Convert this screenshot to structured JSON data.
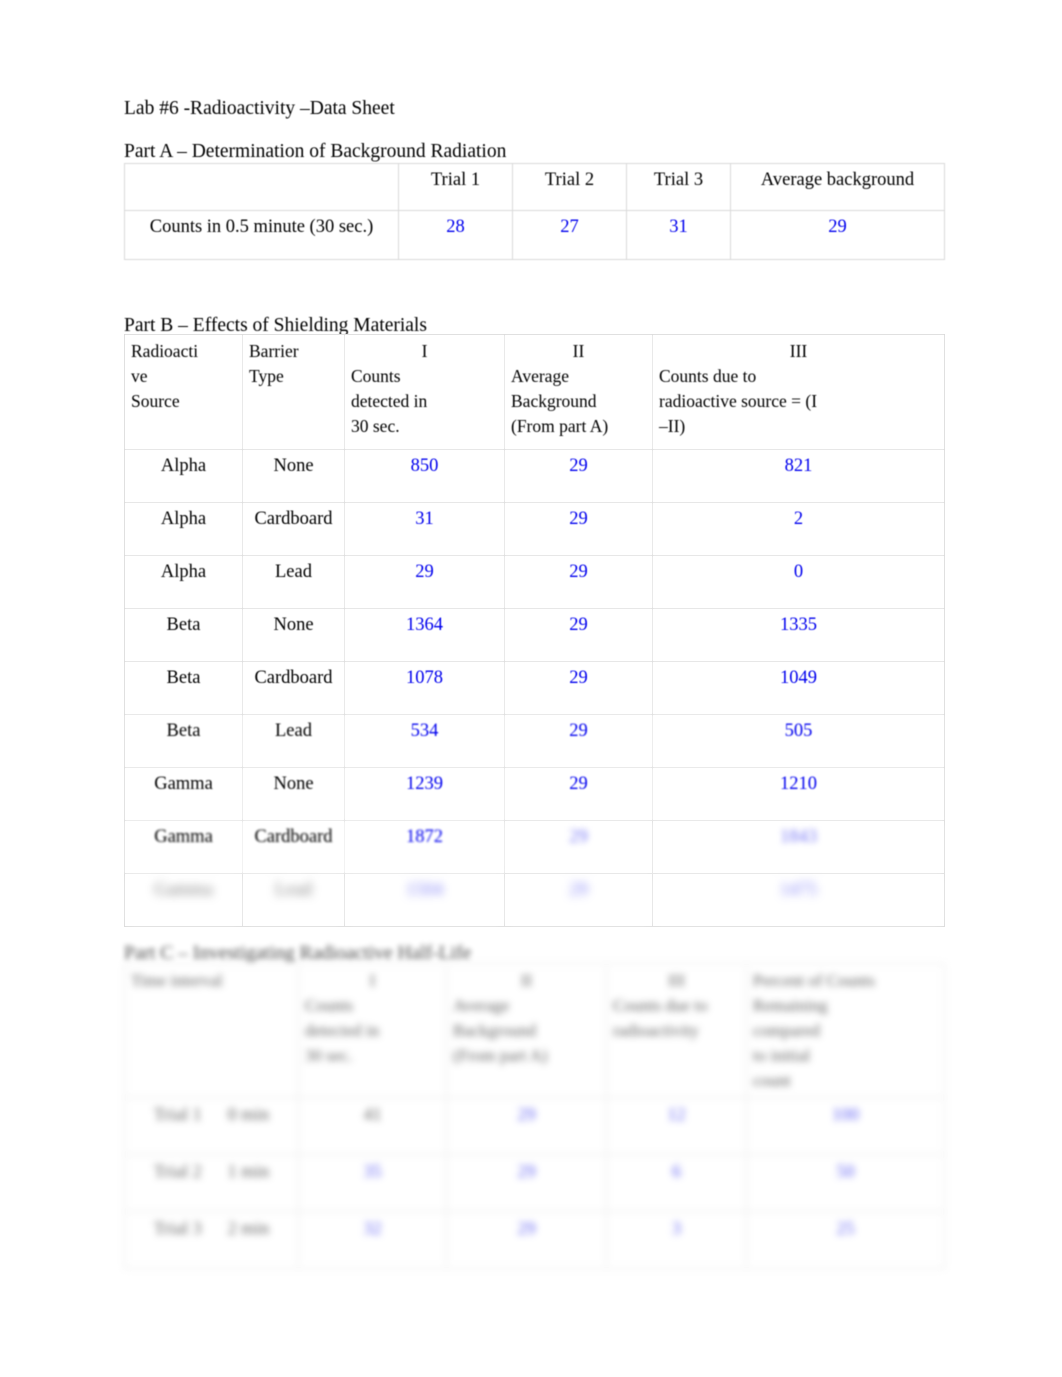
{
  "document": {
    "title": "Lab #6 -Radioactivity –Data Sheet"
  },
  "part_a": {
    "heading": "Part A – Determination of Background Radiation",
    "columns": [
      "",
      "Trial 1",
      "Trial 2",
      "Trial 3",
      "Average background"
    ],
    "row_label": "Counts in 0.5 minute (30 sec.)",
    "values": [
      "28",
      "27",
      "31",
      "29"
    ]
  },
  "part_b": {
    "heading": "Part B – Effects of Shielding Materials",
    "headers": {
      "source": "Radioacti\nve\nSource",
      "source_line1": "Radioacti",
      "source_line2": "ve",
      "source_line3": "Source",
      "barrier_line1": "Barrier",
      "barrier_line2": "Type",
      "col1_num": "I",
      "col1_line1": "Counts",
      "col1_line2": "detected in",
      "col1_line3": "30 sec.",
      "col2_num": "II",
      "col2_line1": "Average",
      "col2_line2": "Background",
      "col2_line3": "(From part A)",
      "col3_num": "III",
      "col3_line1": "Counts due to",
      "col3_line2": "radioactive source = (I",
      "col3_line3": "–II)"
    },
    "rows": [
      {
        "source": "Alpha",
        "barrier": "None",
        "counts": "850",
        "background": "29",
        "net": "821"
      },
      {
        "source": "Alpha",
        "barrier": "Cardboard",
        "counts": "31",
        "background": "29",
        "net": "2"
      },
      {
        "source": "Alpha",
        "barrier": "Lead",
        "counts": "29",
        "background": "29",
        "net": "0"
      },
      {
        "source": "Beta",
        "barrier": "None",
        "counts": "1364",
        "background": "29",
        "net": "1335"
      },
      {
        "source": "Beta",
        "barrier": "Cardboard",
        "counts": "1078",
        "background": "29",
        "net": "1049"
      },
      {
        "source": "Beta",
        "barrier": "Lead",
        "counts": "534",
        "background": "29",
        "net": "505"
      },
      {
        "source": "Gamma",
        "barrier": "None",
        "counts": "1239",
        "background": "29",
        "net": "1210"
      },
      {
        "source": "Gamma",
        "barrier": "Cardboard",
        "counts": "1872",
        "background": "29",
        "net": "1843"
      },
      {
        "source": "Gamma",
        "barrier": "Lead",
        "counts": "1504",
        "background": "29",
        "net": "1475"
      }
    ]
  },
  "part_c": {
    "heading": "Part C – Investigating Radioactive Half-Life",
    "headers": {
      "trial_label": "Time interval",
      "col1_num": "I",
      "col1_line1": "Counts",
      "col1_line2": "detected in",
      "col1_line3": "30 sec.",
      "col2_num": "II",
      "col2_line1": "Average",
      "col2_line2": "Background",
      "col2_line3": "(From part A)",
      "col3_num": "III",
      "col3_line1": "Counts due to",
      "col3_line2": "radioactivity",
      "col4_line1": "Percent of Counts",
      "col4_line2": "Remaining",
      "col4_line3": "compared",
      "col4_line4": "to initial",
      "col4_line5": "count"
    },
    "rows": [
      {
        "trial_a": "Trial 1",
        "trial_b": "0 min",
        "counts": "41",
        "background": "29",
        "net": "12",
        "percent": "100"
      },
      {
        "trial_a": "Trial 2",
        "trial_b": "1 min",
        "counts": "35",
        "background": "29",
        "net": "6",
        "percent": "50"
      },
      {
        "trial_a": "Trial 3",
        "trial_b": "2 min",
        "counts": "32",
        "background": "29",
        "net": "3",
        "percent": "25"
      }
    ]
  }
}
